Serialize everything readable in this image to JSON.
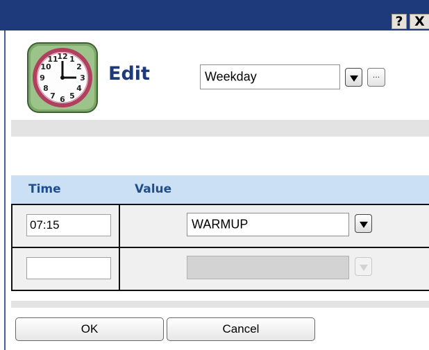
{
  "titlebar": {
    "help_label": "?",
    "close_label": "X",
    "background": "#1f3a7a"
  },
  "header": {
    "title": "Edit",
    "icon": "clock-icon",
    "schedule_select": {
      "value": "Weekday"
    },
    "more_label": "..."
  },
  "grid": {
    "columns": {
      "time": "Time",
      "value": "Value"
    },
    "header_color": "#cce0f5",
    "rows": [
      {
        "time": "07:15",
        "value": "WARMUP",
        "enabled": true
      },
      {
        "time": "",
        "value": "",
        "enabled": false
      }
    ]
  },
  "buttons": {
    "ok": "OK",
    "cancel": "Cancel"
  }
}
